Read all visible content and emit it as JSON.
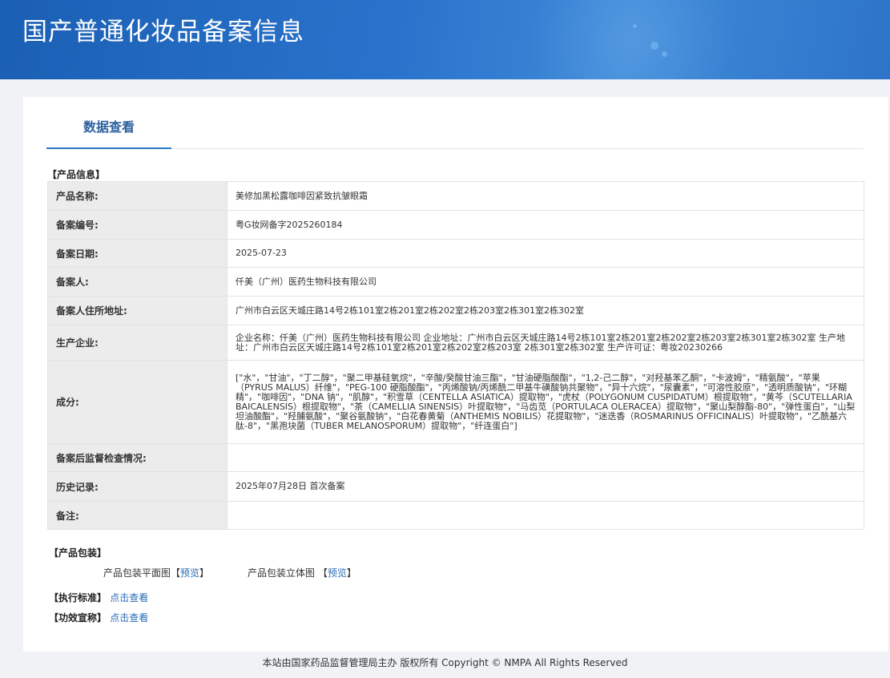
{
  "banner": {
    "title": "国产普通化妆品备案信息"
  },
  "tab": {
    "label": "数据查看"
  },
  "product_info": {
    "section_label": "【产品信息】",
    "rows": [
      {
        "key": "产品名称:",
        "value": "美修加黑松露咖啡因紧致抗皱眼霜"
      },
      {
        "key": "备案编号:",
        "value": "粤G妆网备字2025260184"
      },
      {
        "key": "备案日期:",
        "value": "2025-07-23"
      },
      {
        "key": "备案人:",
        "value": "仟美（广州）医药生物科技有限公司"
      },
      {
        "key": "备案人住所地址:",
        "value": "广州市白云区天城庄路14号2栋101室2栋201室2栋202室2栋203室2栋301室2栋302室"
      },
      {
        "key": "生产企业:",
        "value": "企业名称：仟美（广州）医药生物科技有限公司 企业地址：广州市白云区天城庄路14号2栋101室2栋201室2栋202室2栋203室2栋301室2栋302室 生产地址：广州市白云区天城庄路14号2栋101室2栋201室2栋202室2栋203室 2栋301室2栋302室 生产许可证：粤妆20230266"
      },
      {
        "key": "成分:",
        "value": "[\"水\"，\"甘油\"，\"丁二醇\"，\"聚二甲基硅氧烷\"，\"辛酸/癸酸甘油三酯\"，\"甘油硬脂酸酯\"，\"1,2-己二醇\"，\"对羟基苯乙酮\"，\"卡波姆\"，\"精氨酸\"，\"苹果（PYRUS MALUS）纤维\"，\"PEG-100 硬脂酸酯\"，\"丙烯酸钠/丙烯酰二甲基牛磺酸钠共聚物\"，\"异十六烷\"，\"尿囊素\"，\"可溶性胶原\"，\"透明质酸钠\"，\"环糊精\"，\"咖啡因\"，\"DNA 钠\"，\"肌醇\"，\"积雪草（CENTELLA ASIATICA）提取物\"，\"虎杖（POLYGONUM CUSPIDATUM）根提取物\"，\"黄芩（SCUTELLARIA BAICALENSIS）根提取物\"，\"茶（CAMELLIA SINENSIS）叶提取物\"，\"马齿苋（PORTULACA OLERACEA）提取物\"，\"聚山梨醇酯-80\"，\"弹性蛋白\"，\"山梨坦油酸酯\"，\"羟脯氨酸\"，\"聚谷氨酸钠\"，\"白花春黄菊（ANTHEMIS NOBILIS）花提取物\"，\"迷迭香（ROSMARINUS OFFICINALIS）叶提取物\"，\"乙酰基六肽-8\"，\"黑孢块菌（TUBER MELANOSPORUM）提取物\"，\"纤连蛋白\"]"
      },
      {
        "key": "备案后监督检查情况:",
        "value": ""
      },
      {
        "key": "历史记录:",
        "value": "2025年07月28日 首次备案"
      },
      {
        "key": "备注:",
        "value": ""
      }
    ]
  },
  "packaging": {
    "section_label": "【产品包装】",
    "flat_label": "产品包装平面图",
    "flat_bracket_open": "【",
    "flat_link": "预览",
    "flat_bracket_close": "】",
    "solid_label": "产品包装立体图",
    "solid_bracket_open": "【",
    "solid_link": "预览",
    "solid_bracket_close": "】"
  },
  "standard": {
    "label": "【执行标准】",
    "link": "点击查看"
  },
  "efficacy": {
    "label": "【功效宣称】",
    "link": "点击查看"
  },
  "footer": {
    "text": "本站由国家药品监督管理局主办 版权所有 Copyright © NMPA All Rights Reserved"
  }
}
